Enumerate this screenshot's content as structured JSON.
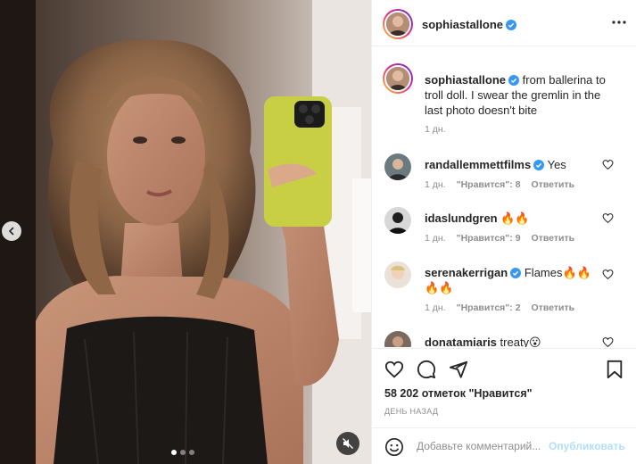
{
  "post": {
    "author": "sophiastallone",
    "author_verified": true,
    "carousel": {
      "slide_count": 3,
      "active_slide": 1
    }
  },
  "caption": {
    "username": "sophiastallone",
    "text": "from ballerina to troll doll. I swear the gremlin in the last photo doesn't bite",
    "time": "1 дн."
  },
  "comments": [
    {
      "username": "randallemmettfilms",
      "verified": true,
      "text": "Yes",
      "time": "1 дн.",
      "likes": "\"Нравится\": 8",
      "reply": "Ответить"
    },
    {
      "username": "idaslundgren",
      "verified": false,
      "text": "🔥🔥",
      "time": "1 дн.",
      "likes": "\"Нравится\": 9",
      "reply": "Ответить"
    },
    {
      "username": "serenakerrigan",
      "verified": true,
      "text": "Flames🔥🔥🔥🔥",
      "time": "1 дн.",
      "likes": "\"Нравится\": 2",
      "reply": "Ответить"
    },
    {
      "username": "donatamiaris",
      "verified": false,
      "text": "treaty😮",
      "time": "",
      "likes": "",
      "reply": ""
    }
  ],
  "footer": {
    "likes_text": "58 202 отметок \"Нравится\"",
    "date": "ДЕНЬ НАЗАД",
    "comment_placeholder": "Добавьте комментарий...",
    "post_button": "Опубликовать"
  },
  "icons": {
    "verified": "verified-badge-icon",
    "like": "heart-icon",
    "comment": "comment-icon",
    "share": "paper-plane-icon",
    "save": "bookmark-icon",
    "emoji": "smiley-icon",
    "more": "more-dots-icon",
    "mute": "muted-speaker-icon",
    "prev": "chevron-left-icon"
  },
  "colors": {
    "verified": "#3897f0",
    "text": "#262626",
    "muted": "#8e8e8e",
    "post_button_disabled": "#b2dffc",
    "phone_case": "#c9cf45"
  }
}
